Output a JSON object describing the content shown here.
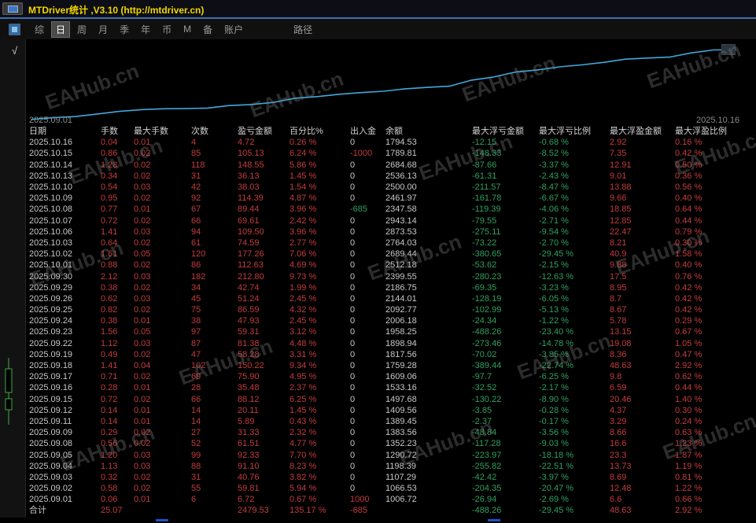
{
  "window": {
    "title": "MTDriver统计 ,V3.10 (http://mtdriver.cn)"
  },
  "menu": {
    "items": [
      "综",
      "日",
      "周",
      "月",
      "季",
      "年",
      "币",
      "M",
      "备",
      "账户"
    ],
    "selected": "日",
    "path_label": "路径",
    "check_icon": "√"
  },
  "chart": {
    "type": "line",
    "line_color": "#3fa9dc",
    "start_label": "2025.09.01",
    "end_label": "2025.10.16",
    "watermark": "EAHub.cn",
    "values": [
      6.72,
      66.53,
      107.29,
      198.39,
      290.72,
      352.23,
      383.56,
      389.45,
      409.56,
      497.68,
      533.16,
      609.06,
      759.28,
      817.56,
      898.94,
      958.25,
      1006.18,
      1092.77,
      1144.01,
      1186.75,
      1399.55,
      1512.18,
      1689.44,
      1764.03,
      1873.53,
      1943.14,
      2032.58,
      2146.97,
      2185.0,
      2221.13,
      2369.68,
      2474.81,
      2479.53
    ]
  },
  "table": {
    "headers": [
      "日期",
      "手数",
      "最大手数",
      "次数",
      "盈亏金额",
      "百分比%",
      "出入金",
      "余额",
      "最大浮亏金额",
      "最大浮亏比例",
      "最大浮盈金额",
      "最大浮盈比例"
    ],
    "rows": [
      {
        "c": [
          "2025.10.16",
          "0.04",
          "0.01",
          "4",
          "4.72",
          "0.26 %",
          "0",
          "1794.53",
          "-12.15",
          "-0.68 %",
          "2.92",
          "0.16 %"
        ],
        "io": "zero"
      },
      {
        "c": [
          "2025.10.15",
          "0.86",
          "0.02",
          "85",
          "105.13",
          "6.24 %",
          "-1000",
          "1789.81",
          "-148.33",
          "-8.52 %",
          "7.35",
          "0.42 %"
        ],
        "io": "red"
      },
      {
        "c": [
          "2025.10.14",
          "1.28",
          "0.02",
          "118",
          "148.55",
          "5.86 %",
          "0",
          "2684.68",
          "-87.66",
          "-3.37 %",
          "12.91",
          "0.50 %"
        ],
        "io": "zero"
      },
      {
        "c": [
          "2025.10.13",
          "0.34",
          "0.02",
          "31",
          "36.13",
          "1.45 %",
          "0",
          "2536.13",
          "-61.31",
          "-2.43 %",
          "9.01",
          "0.36 %"
        ],
        "io": "zero"
      },
      {
        "c": [
          "2025.10.10",
          "0.54",
          "0.03",
          "42",
          "38.03",
          "1.54 %",
          "0",
          "2500.00",
          "-211.57",
          "-8.47 %",
          "13.88",
          "0.56 %"
        ],
        "io": "zero"
      },
      {
        "c": [
          "2025.10.09",
          "0.95",
          "0.02",
          "92",
          "114.39",
          "4.87 %",
          "0",
          "2461.97",
          "-161.78",
          "-6.67 %",
          "9.66",
          "0.40 %"
        ],
        "io": "zero"
      },
      {
        "c": [
          "2025.10.08",
          "0.77",
          "0.01",
          "67",
          "89.44",
          "3.96 %",
          "-685",
          "2347.58",
          "-119.39",
          "-4.06 %",
          "18.85",
          "0.64 %"
        ],
        "io": "green"
      },
      {
        "c": [
          "2025.10.07",
          "0.72",
          "0.02",
          "66",
          "69.61",
          "2.42 %",
          "0",
          "2943.14",
          "-79.55",
          "-2.71 %",
          "12.85",
          "0.44 %"
        ],
        "io": "zero"
      },
      {
        "c": [
          "2025.10.06",
          "1.41",
          "0.03",
          "94",
          "109.50",
          "3.96 %",
          "0",
          "2873.53",
          "-275.11",
          "-9.54 %",
          "22.47",
          "0.79 %"
        ],
        "io": "zero"
      },
      {
        "c": [
          "2025.10.03",
          "0.64",
          "0.02",
          "61",
          "74.59",
          "2.77 %",
          "0",
          "2764.03",
          "-73.22",
          "-2.70 %",
          "8.21",
          "0.30 %"
        ],
        "io": "zero"
      },
      {
        "c": [
          "2025.10.02",
          "1.61",
          "0.05",
          "120",
          "177.26",
          "7.06 %",
          "0",
          "2689.44",
          "-380.65",
          "-29.45 %",
          "40.9",
          "1.58 %"
        ],
        "io": "zero"
      },
      {
        "c": [
          "2025.10.01",
          "0.88",
          "0.02",
          "86",
          "112.63",
          "4.69 %",
          "0",
          "2512.18",
          "-53.62",
          "-2.15 %",
          "9.88",
          "0.40 %"
        ],
        "io": "zero"
      },
      {
        "c": [
          "2025.09.30",
          "2.12",
          "0.03",
          "182",
          "212.80",
          "9.73 %",
          "0",
          "2399.55",
          "-280.23",
          "-12.63 %",
          "17.5",
          "0.76 %"
        ],
        "io": "zero"
      },
      {
        "c": [
          "2025.09.29",
          "0.38",
          "0.02",
          "34",
          "42.74",
          "1.99 %",
          "0",
          "2186.75",
          "-69.35",
          "-3.23 %",
          "8.95",
          "0.42 %"
        ],
        "io": "zero"
      },
      {
        "c": [
          "2025.09.26",
          "0.62",
          "0.03",
          "45",
          "51.24",
          "2.45 %",
          "0",
          "2144.01",
          "-128.19",
          "-6.05 %",
          "8.7",
          "0.42 %"
        ],
        "io": "zero"
      },
      {
        "c": [
          "2025.09.25",
          "0.82",
          "0.02",
          "75",
          "86.59",
          "4.32 %",
          "0",
          "2092.77",
          "-102.99",
          "-5.13 %",
          "8.67",
          "0.42 %"
        ],
        "io": "zero"
      },
      {
        "c": [
          "2025.09.24",
          "0.38",
          "0.01",
          "38",
          "47.93",
          "2.45 %",
          "0",
          "2006.18",
          "-24.34",
          "-1.22 %",
          "5.78",
          "0.29 %"
        ],
        "io": "zero"
      },
      {
        "c": [
          "2025.09.23",
          "1.56",
          "0.05",
          "97",
          "59.31",
          "3.12 %",
          "0",
          "1958.25",
          "-488.26",
          "-23.40 %",
          "13.15",
          "0.67 %"
        ],
        "io": "zero"
      },
      {
        "c": [
          "2025.09.22",
          "1.12",
          "0.03",
          "87",
          "81.38",
          "4.48 %",
          "0",
          "1898.94",
          "-273.46",
          "-14.78 %",
          "19.08",
          "1.05 %"
        ],
        "io": "zero"
      },
      {
        "c": [
          "2025.09.19",
          "0.49",
          "0.02",
          "47",
          "58.28",
          "3.31 %",
          "0",
          "1817.56",
          "-70.02",
          "-3.85 %",
          "8.36",
          "0.47 %"
        ],
        "io": "zero"
      },
      {
        "c": [
          "2025.09.18",
          "1.41",
          "0.04",
          "102",
          "150.22",
          "9.34 %",
          "0",
          "1759.28",
          "-389.44",
          "-22.74 %",
          "48.63",
          "2.92 %"
        ],
        "io": "zero"
      },
      {
        "c": [
          "2025.09.17",
          "0.71",
          "0.02",
          "69",
          "75.90",
          "4.95 %",
          "0",
          "1609.06",
          "-97.7",
          "-6.25 %",
          "9.8",
          "0.62 %"
        ],
        "io": "zero"
      },
      {
        "c": [
          "2025.09.16",
          "0.28",
          "0.01",
          "28",
          "35.48",
          "2.37 %",
          "0",
          "1533.16",
          "-32.52",
          "-2.17 %",
          "6.59",
          "0.44 %"
        ],
        "io": "zero"
      },
      {
        "c": [
          "2025.09.15",
          "0.72",
          "0.02",
          "66",
          "88.12",
          "6.25 %",
          "0",
          "1497.68",
          "-130.22",
          "-8.90 %",
          "20.46",
          "1.40 %"
        ],
        "io": "zero"
      },
      {
        "c": [
          "2025.09.12",
          "0.14",
          "0.01",
          "14",
          "20.11",
          "1.45 %",
          "0",
          "1409.56",
          "-3.85",
          "-0.28 %",
          "4.37",
          "0.30 %"
        ],
        "io": "zero"
      },
      {
        "c": [
          "2025.09.11",
          "0.14",
          "0.01",
          "14",
          "5.89",
          "0.43 %",
          "0",
          "1389.45",
          "-2.37",
          "-0.17 %",
          "3.29",
          "0.24 %"
        ],
        "io": "zero"
      },
      {
        "c": [
          "2025.09.09",
          "0.29",
          "0.02",
          "27",
          "31.33",
          "2.32 %",
          "0",
          "1383.56",
          "-48.84",
          "-3.56 %",
          "8.66",
          "0.63 %"
        ],
        "io": "zero"
      },
      {
        "c": [
          "2025.09.08",
          "0.56",
          "0.02",
          "52",
          "61.51",
          "4.77 %",
          "0",
          "1352.23",
          "-117.28",
          "-9.03 %",
          "16.6",
          "1.23 %"
        ],
        "io": "zero"
      },
      {
        "c": [
          "2025.09.05",
          "1.20",
          "0.03",
          "99",
          "92.33",
          "7.70 %",
          "0",
          "1290.72",
          "-223.97",
          "-18.18 %",
          "23.3",
          "1.87 %"
        ],
        "io": "zero"
      },
      {
        "c": [
          "2025.09.04",
          "1.13",
          "0.03",
          "88",
          "91.10",
          "8.23 %",
          "0",
          "1198.39",
          "-255.82",
          "-22.51 %",
          "13.73",
          "1.19 %"
        ],
        "io": "zero"
      },
      {
        "c": [
          "2025.09.03",
          "0.32",
          "0.02",
          "31",
          "40.76",
          "3.82 %",
          "0",
          "1107.29",
          "-42.42",
          "-3.97 %",
          "8.69",
          "0.81 %"
        ],
        "io": "zero"
      },
      {
        "c": [
          "2025.09.02",
          "0.58",
          "0.02",
          "55",
          "59.81",
          "5.94 %",
          "0",
          "1066.53",
          "-204.35",
          "-20.47 %",
          "12.48",
          "1.22 %"
        ],
        "io": "zero"
      },
      {
        "c": [
          "2025.09.01",
          "0.06",
          "0.01",
          "6",
          "6.72",
          "0.67 %",
          "1000",
          "1006.72",
          "-26.94",
          "-2.69 %",
          "6.6",
          "0.66 %"
        ],
        "io": "red"
      }
    ],
    "total": {
      "c": [
        "合计",
        "25.07",
        "",
        "",
        "2479.53",
        "135.17 %",
        "-685",
        "",
        "-488.26",
        "-29.45 %",
        "48.63",
        "2.92 %"
      ],
      "io": "red"
    }
  },
  "colors": {
    "title_text": "#f2d800",
    "accent_line": "#3c6eb4",
    "profit_red": "#c43c3c",
    "loss_green": "#2fa05f",
    "chart_line": "#3fa9dc"
  }
}
